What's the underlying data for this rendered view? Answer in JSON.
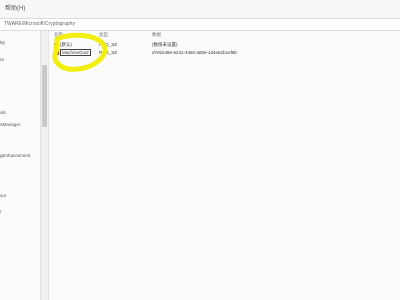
{
  "menu": {
    "help": "帮助(H)"
  },
  "address": {
    "path": "TWARE\\Microsoft\\Cryptography"
  },
  "tree": {
    "items": [
      "ttp",
      "nt",
      "",
      "ols",
      "nManager",
      "gEnhancement",
      "sor",
      "r",
      "",
      ""
    ]
  },
  "table": {
    "headers": {
      "name": "名称",
      "type": "类型",
      "data": "数据"
    },
    "rows": [
      {
        "name": "(默认)",
        "type": "REG_SZ",
        "data": "(数值未设置)",
        "icon": "string-value-icon"
      },
      {
        "name": "MachineGuid",
        "type": "REG_SZ",
        "data": "d7eb248e-6241-4460-a80e-1d4e52b1ef6b",
        "icon": "string-value-icon"
      }
    ]
  },
  "annotation": {
    "color": "#f2ee10"
  }
}
